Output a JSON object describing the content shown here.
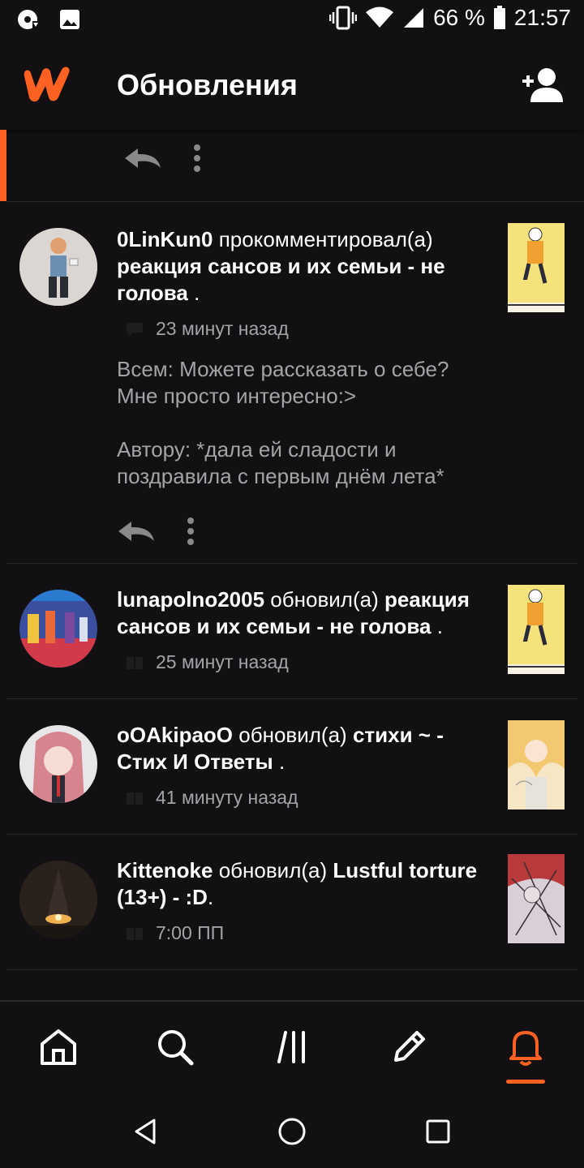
{
  "status_bar": {
    "battery": "66 %",
    "time": "21:57",
    "icons": [
      "download-icon",
      "image-icon",
      "vibrate-icon",
      "wifi-icon",
      "signal-icon",
      "battery-icon"
    ]
  },
  "header": {
    "title": "Обновления",
    "logo_icon": "wattpad-logo-icon",
    "action_icon": "add-user-icon"
  },
  "colors": {
    "accent": "#ff6122",
    "background": "#121013",
    "muted_text": "#a5a3a6",
    "divider": "#2b292c"
  },
  "feed": {
    "items": [
      {
        "user": "0LinKun0",
        "verb": "прокомментировал(а)",
        "story": "реакция сансов и их семьи - не голова",
        "suffix": " .",
        "time": "23 минут назад",
        "comment": "Всем: Можете рассказать о себе? Мне просто интересно:>\n\nАвтору: *дала ей сладости и поздравила с первым днём лета*"
      },
      {
        "user": "lunapolno2005",
        "verb": "обновил(а)",
        "story": "реакция сансов и их семьи - не голова",
        "suffix": " .",
        "time": "25 минут назад"
      },
      {
        "user": "oOAkipaoO",
        "verb": "обновил(а)",
        "story": "стихи ~ - Стих И Ответы",
        "suffix": " .",
        "time": "41 минуту назад"
      },
      {
        "user": "Kittenoke",
        "verb": "обновил(а)",
        "story": "Lustful torture (13+) - :D",
        "suffix": ".",
        "time": "7:00 ПП"
      }
    ]
  },
  "bottom_nav": [
    "home-icon",
    "search-icon",
    "library-icon",
    "write-icon",
    "notifications-icon"
  ],
  "system_nav": [
    "back-icon",
    "home-circle-icon",
    "recents-icon"
  ]
}
